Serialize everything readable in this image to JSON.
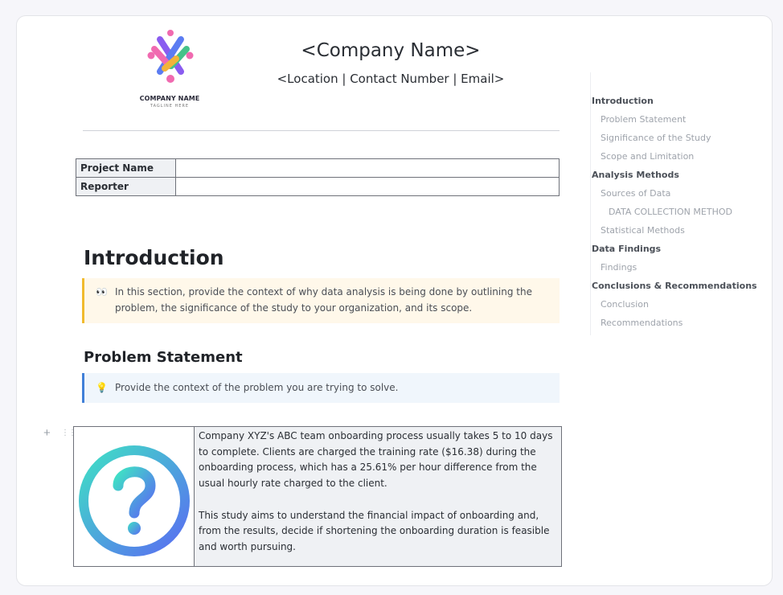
{
  "header": {
    "logo_name": "COMPANY NAME",
    "logo_tagline": "TAGLINE HERE",
    "company_name": "<Company Name>",
    "contact_line": "<Location | Contact Number | Email>"
  },
  "meta_table": {
    "rows": [
      {
        "label": "Project Name",
        "value": ""
      },
      {
        "label": "Reporter",
        "value": ""
      }
    ]
  },
  "introduction": {
    "heading": "Introduction",
    "callout_icon": "eyes-icon",
    "callout_line1": "In this section, provide the context of why data analysis is being done by outlining the",
    "callout_line2": "problem, the significance of the study to your organization, and its scope."
  },
  "problem_statement": {
    "heading": "Problem Statement",
    "callout_icon": "lightbulb-icon",
    "callout_text": "Provide the context of the problem you are trying to solve.",
    "image_icon": "question-mark-icon",
    "paragraph1": "Company XYZ's ABC team onboarding process usually takes 5 to 10 days to complete. Clients are charged the training rate ($16.38) during the onboarding process, which has a 25.61% per hour difference from the usual hourly rate charged to the client.",
    "paragraph2": "This study aims to understand the financial impact of onboarding and, from the results, decide if shortening the onboarding duration is feasible and worth pursuing."
  },
  "toc": {
    "items": [
      {
        "label": "Introduction",
        "level": 1
      },
      {
        "label": "Problem Statement",
        "level": 2
      },
      {
        "label": "Significance of the Study",
        "level": 2
      },
      {
        "label": "Scope and Limitation",
        "level": 2
      },
      {
        "label": "Analysis Methods",
        "level": 1
      },
      {
        "label": "Sources of Data",
        "level": 2
      },
      {
        "label": "DATA COLLECTION METHOD",
        "level": 3
      },
      {
        "label": "Statistical Methods",
        "level": 2
      },
      {
        "label": "Data Findings",
        "level": 1
      },
      {
        "label": "Findings",
        "level": 2
      },
      {
        "label": "Conclusions & Recommendations",
        "level": 1
      },
      {
        "label": "Conclusion",
        "level": 2
      },
      {
        "label": "Recommendations",
        "level": 2
      }
    ]
  },
  "colors": {
    "accent_yellow": "#f1bb2f",
    "accent_blue": "#4180d8",
    "callout_yellow_bg": "#fff8ea",
    "callout_blue_bg": "#f0f6fc"
  }
}
